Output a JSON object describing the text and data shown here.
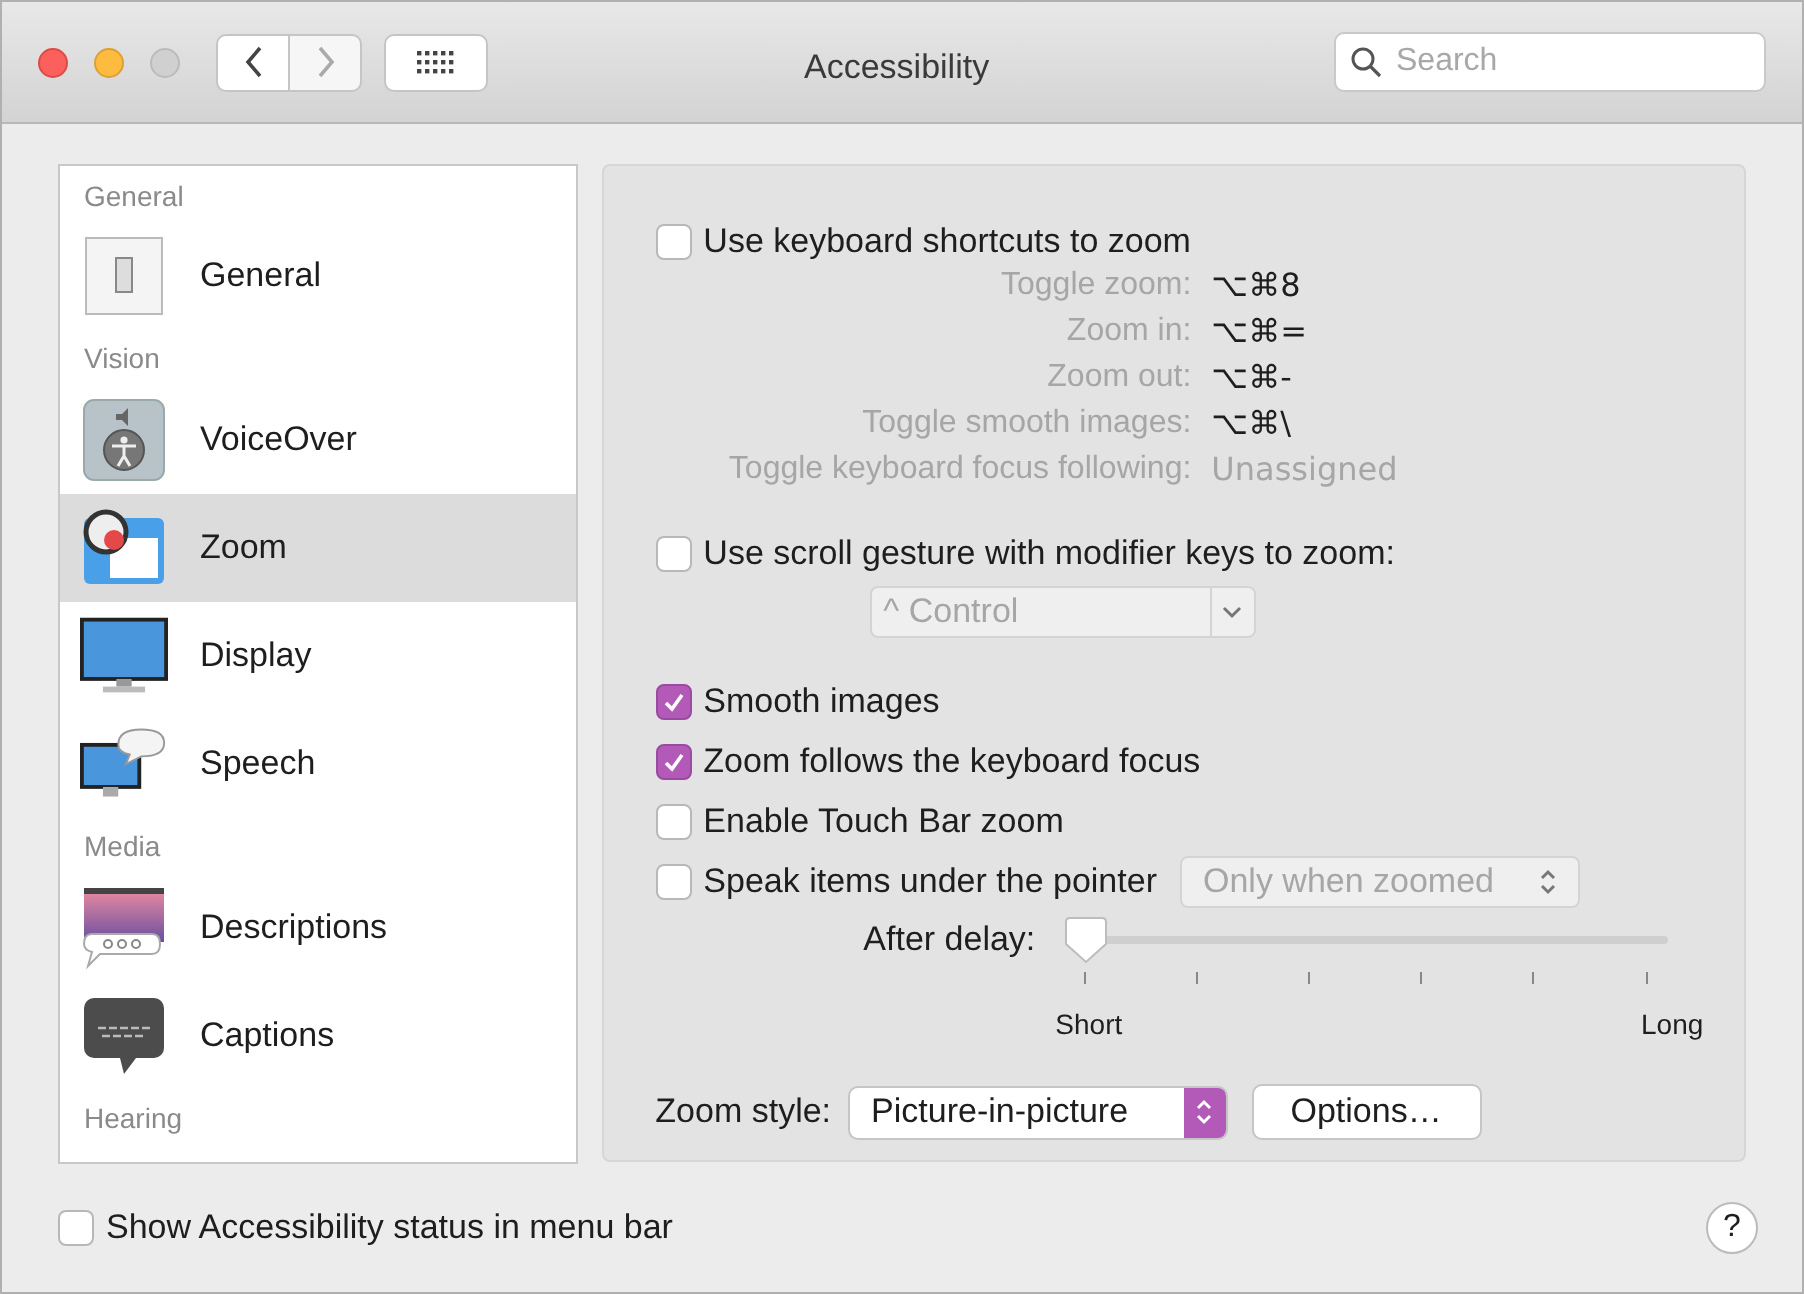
{
  "window": {
    "title": "Accessibility"
  },
  "toolbar": {
    "search": {
      "placeholder": "Search"
    }
  },
  "sidebar": {
    "items": [
      {
        "kind": "header",
        "label": "General"
      },
      {
        "kind": "item",
        "label": "General",
        "selected": false
      },
      {
        "kind": "header",
        "label": "Vision"
      },
      {
        "kind": "item",
        "label": "VoiceOver",
        "selected": false
      },
      {
        "kind": "item",
        "label": "Zoom",
        "selected": true
      },
      {
        "kind": "item",
        "label": "Display",
        "selected": false
      },
      {
        "kind": "item",
        "label": "Speech",
        "selected": false
      },
      {
        "kind": "header",
        "label": "Media"
      },
      {
        "kind": "item",
        "label": "Descriptions",
        "selected": false
      },
      {
        "kind": "item",
        "label": "Captions",
        "selected": false
      },
      {
        "kind": "header",
        "label": "Hearing"
      }
    ]
  },
  "panel": {
    "keyboard_shortcuts": {
      "label": "Use keyboard shortcuts to zoom",
      "checked": false,
      "shortcuts": [
        {
          "label": "Toggle zoom:",
          "value": "⌥⌘8",
          "assigned": true
        },
        {
          "label": "Zoom in:",
          "value": "⌥⌘=",
          "assigned": true
        },
        {
          "label": "Zoom out:",
          "value": "⌥⌘-",
          "assigned": true
        },
        {
          "label": "Toggle smooth images:",
          "value": "⌥⌘\\",
          "assigned": true
        },
        {
          "label": "Toggle keyboard focus following:",
          "value": "Unassigned",
          "assigned": false
        }
      ]
    },
    "scroll_gesture": {
      "label": "Use scroll gesture with modifier keys to zoom:",
      "checked": false,
      "modifier": {
        "value": "^ Control",
        "disabled": true
      }
    },
    "checkboxes": [
      {
        "label": "Smooth images",
        "checked": true
      },
      {
        "label": "Zoom follows the keyboard focus",
        "checked": true
      },
      {
        "label": "Enable Touch Bar zoom",
        "checked": false
      }
    ],
    "speak_items": {
      "label": "Speak items under the pointer",
      "checked": false,
      "mode": {
        "value": "Only when zoomed",
        "disabled": true
      },
      "delay": {
        "label": "After delay:",
        "level": 0,
        "min_label": "Short",
        "max_label": "Long"
      }
    },
    "zoom_style": {
      "label": "Zoom style:",
      "value": "Picture-in-picture"
    },
    "options_button": "Options…"
  },
  "status_checkbox": {
    "label": "Show Accessibility status in menu bar",
    "checked": false
  },
  "help_button": "?"
}
